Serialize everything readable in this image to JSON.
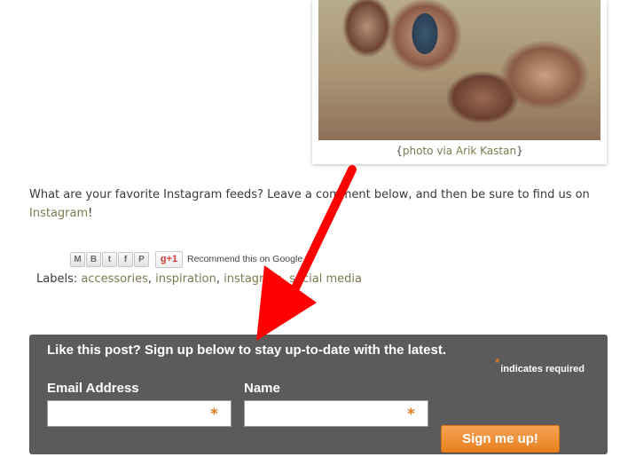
{
  "photo": {
    "caption_open": "{",
    "caption_link": "photo via Arik Kastan",
    "caption_close": "}"
  },
  "post": {
    "question_text": "What are your favorite Instagram feeds? Leave a comment below, and then be sure to find us on ",
    "instagram_link": "Instagram",
    "end_punct": "!"
  },
  "share": {
    "buttons": [
      {
        "icon": "email-icon",
        "glyph": "M"
      },
      {
        "icon": "blogger-icon",
        "glyph": "B"
      },
      {
        "icon": "twitter-icon",
        "glyph": "t"
      },
      {
        "icon": "facebook-icon",
        "glyph": "f"
      },
      {
        "icon": "pinterest-icon",
        "glyph": "P"
      }
    ],
    "gplus_label": "g+1",
    "recommend_text": "Recommend this on Google"
  },
  "labels": {
    "prefix": "Labels:",
    "items": [
      "accessories",
      "inspiration",
      "instagram",
      "social media"
    ]
  },
  "signup": {
    "heading": "Like this post? Sign up below to stay up-to-date with the latest.",
    "required_star": "*",
    "required_text": "indicates required",
    "email_label": "Email Address",
    "name_label": "Name",
    "email_value": "",
    "name_value": "",
    "field_star": "*",
    "submit_label": "Sign me up!"
  },
  "colors": {
    "link": "#7c7a4f",
    "signup_bg": "#5b5b5b",
    "accent_orange": "#e8801f",
    "annotation_arrow": "#ff0000"
  }
}
